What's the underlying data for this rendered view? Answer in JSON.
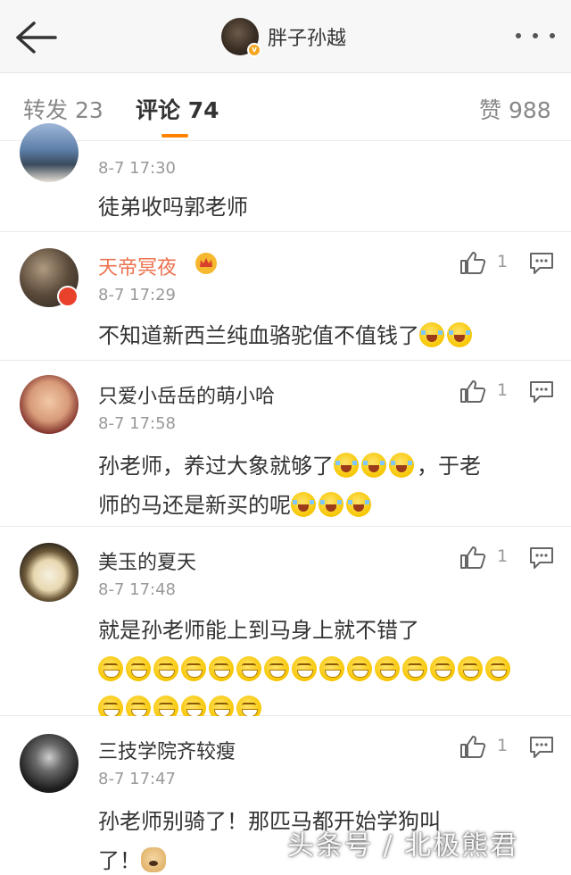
{
  "header": {
    "back_icon": "arrow-left-icon",
    "title": "胖子孙越",
    "verified_badge": "v",
    "more_icon": "ellipsis-icon"
  },
  "tabs": [
    {
      "label": "转发",
      "count": "23"
    },
    {
      "label": "评论",
      "count": "74"
    },
    {
      "label": "赞",
      "count": "988"
    }
  ],
  "comments": [
    {
      "name": "",
      "time": "8-7 17:30",
      "text": "徒弟收吗郭老师",
      "likes": ""
    },
    {
      "name": "天帝冥夜",
      "time": "8-7 17:29",
      "text": "不知道新西兰纯血骆驼值不值钱了",
      "likes": "1",
      "emoji": [
        "cry",
        "cry"
      ]
    },
    {
      "name": "只爱小岳岳的萌小哈",
      "time": "8-7 17:58",
      "text_a": "孙老师，养过大象就够了",
      "text_b": "，于老",
      "text_c": "师的马还是新买的呢",
      "likes": "1"
    },
    {
      "name": "美玉的夏天",
      "time": "8-7 17:48",
      "text": "就是孙老师能上到马身上就不错了",
      "likes": "1"
    },
    {
      "name": "三技学院齐较瘦",
      "time": "8-7 17:47",
      "text_a": "孙老师别骑了！那匹马都开始学狗叫",
      "text_b": "了！",
      "likes": "1"
    }
  ],
  "watermark": "头条号 / 北极熊君",
  "colors": {
    "accent": "#ff8200",
    "vip_name": "#eb7350"
  }
}
